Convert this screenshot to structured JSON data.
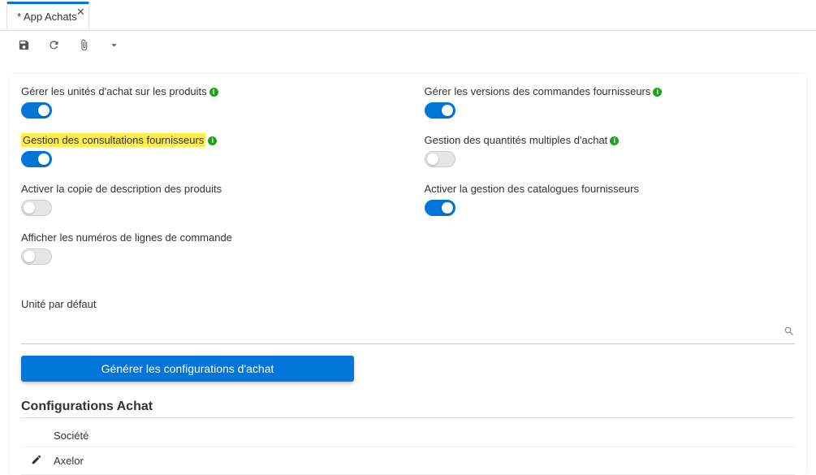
{
  "tab": {
    "title": "* App Achats"
  },
  "left_fields": [
    {
      "label": "Gérer les unités d'achat sur les produits",
      "info": true,
      "on": true,
      "highlight": false
    },
    {
      "label": "Gestion des consultations fournisseurs",
      "info": true,
      "on": true,
      "highlight": true
    },
    {
      "label": "Activer la copie de description des produits",
      "info": false,
      "on": false,
      "highlight": false
    },
    {
      "label": "Afficher les numéros de lignes de commande",
      "info": false,
      "on": false,
      "highlight": false
    }
  ],
  "right_fields": [
    {
      "label": "Gérer les versions des commandes fournisseurs",
      "info": true,
      "on": true
    },
    {
      "label": "Gestion des quantités multiples d'achat",
      "info": true,
      "on": false
    },
    {
      "label": "Activer la gestion des catalogues fournisseurs",
      "info": false,
      "on": true
    }
  ],
  "unit": {
    "label": "Unité par défaut",
    "value": ""
  },
  "generate_button": "Générer les configurations d'achat",
  "section": {
    "title": "Configurations Achat"
  },
  "table": {
    "header": "Société",
    "rows": [
      {
        "value": "Axelor"
      }
    ]
  }
}
